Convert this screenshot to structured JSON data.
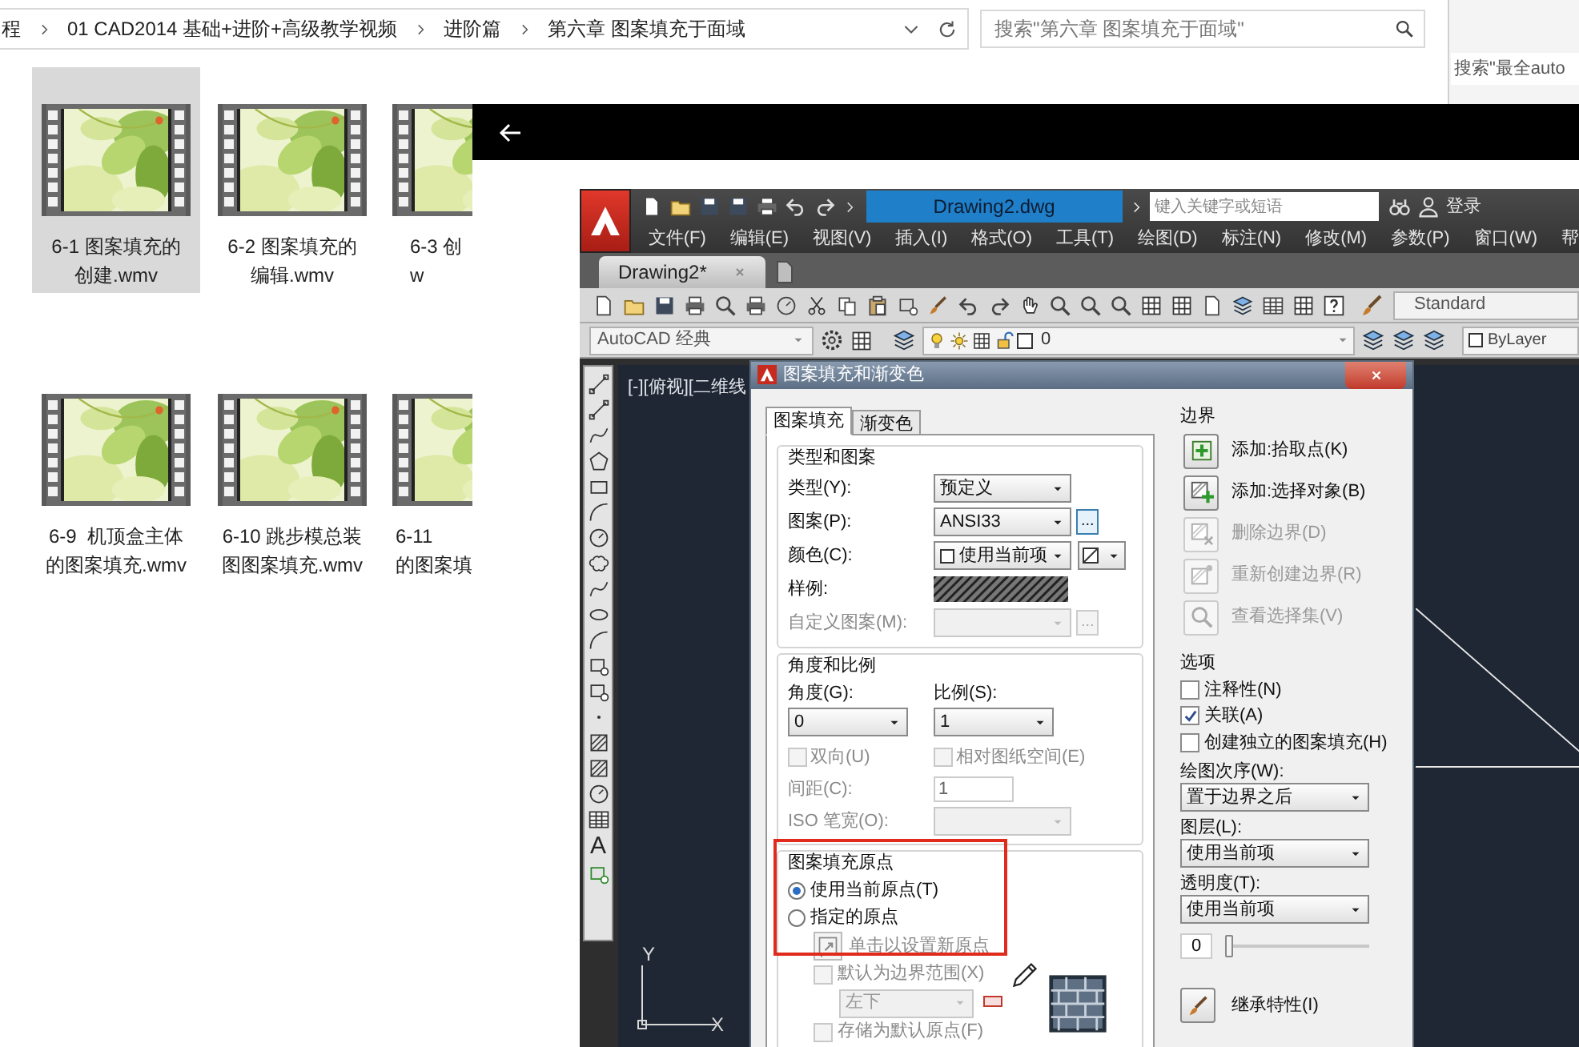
{
  "explorer": {
    "breadcrumb": [
      "程",
      "01 CAD2014 基础+进阶+高级教学视频",
      "进阶篇",
      "第六章 图案填充于面域"
    ],
    "search": {
      "placeholder": "搜索\"第六章 图案填充于面域\""
    },
    "files": [
      {
        "lines": [
          "6-1 图案填充的",
          "创建.wmv"
        ],
        "selected": true
      },
      {
        "lines": [
          "6-2 图案填充的",
          "编辑.wmv"
        ],
        "selected": false
      },
      {
        "lines": [
          "6-3 创",
          "w"
        ],
        "selected": false
      },
      {
        "lines": [
          "6-9  机顶盒主体",
          "的图案填充.wmv"
        ],
        "selected": false
      },
      {
        "lines": [
          "6-10 跳步模总装",
          "图图案填充.wmv"
        ],
        "selected": false
      },
      {
        "lines": [
          "6-11",
          "的图案填"
        ],
        "selected": false
      }
    ]
  },
  "background_window": {
    "search": {
      "placeholder": "搜索\"最全auto"
    }
  },
  "cad": {
    "title": "Drawing2.dwg",
    "search": {
      "placeholder": "键入关键字或短语"
    },
    "sign_in": "登录",
    "menu": [
      "文件(F)",
      "编辑(E)",
      "视图(V)",
      "插入(I)",
      "格式(O)",
      "工具(T)",
      "绘图(D)",
      "标注(N)",
      "修改(M)",
      "参数(P)",
      "窗口(W)",
      "帮"
    ],
    "doc_tab": "Drawing2*",
    "text_style": "Standard",
    "workspace": "AutoCAD 经典",
    "layer": "0",
    "color_control": "ByLayer",
    "viewport_label": "[-][俯视][二维线",
    "text_tool": "A",
    "ucs": {
      "y": "Y",
      "x": "X"
    }
  },
  "dialog": {
    "title": "图案填充和渐变色",
    "tabs": [
      {
        "label": "图案填充",
        "selected": true
      },
      {
        "label": "渐变色",
        "selected": false
      }
    ],
    "type_pattern": {
      "title": "类型和图案",
      "rows": [
        {
          "kind": "dropdown",
          "label": "类型(Y):",
          "value": "预定义",
          "disabled": false
        },
        {
          "kind": "browse",
          "label": "图案(P):",
          "value": "ANSI33",
          "browse": "...",
          "disabled": false
        },
        {
          "kind": "color",
          "label": "颜色(C):",
          "value": "使用当前项",
          "disabled": false
        },
        {
          "kind": "swatch",
          "label": "样例:"
        },
        {
          "kind": "browse",
          "label": "自定义图案(M):",
          "browse": "...",
          "disabled": true
        }
      ]
    },
    "angle_scale": {
      "title": "角度和比例",
      "angle": {
        "label": "角度(G):",
        "value": "0"
      },
      "scale": {
        "label": "比例(S):",
        "value": "1"
      },
      "checks": [
        {
          "label": "双向(U)",
          "checked": false,
          "disabled": true
        },
        {
          "label": "相对图纸空间(E)",
          "checked": false,
          "disabled": true
        }
      ],
      "spacing": {
        "label": "间距(C):",
        "value": "1",
        "disabled": true
      },
      "iso": {
        "label": "ISO 笔宽(O):",
        "disabled": true
      }
    },
    "origin": {
      "title": "图案填充原点",
      "radios": [
        {
          "label": "使用当前原点(T)",
          "selected": true
        },
        {
          "label": "指定的原点",
          "selected": false
        }
      ],
      "set_button": {
        "label": "单击以设置新原点",
        "disabled": true
      },
      "default_extents": {
        "label": "默认为边界范围(X)",
        "checked": false,
        "disabled": true
      },
      "position": {
        "value": "左下",
        "disabled": true
      },
      "store_default": {
        "label": "存储为默认原点(F)",
        "checked": false,
        "disabled": true
      }
    },
    "boundaries": {
      "title": "边界",
      "buttons": [
        {
          "kind": "pick_points",
          "label": "添加:拾取点(K)",
          "disabled": false
        },
        {
          "kind": "select_objects",
          "label": "添加:选择对象(B)",
          "disabled": false
        },
        {
          "kind": "remove",
          "label": "删除边界(D)",
          "disabled": true
        },
        {
          "kind": "recreate",
          "label": "重新创建边界(R)",
          "disabled": true
        },
        {
          "kind": "view_selection",
          "label": "查看选择集(V)",
          "disabled": true
        }
      ]
    },
    "options": {
      "title": "选项",
      "checks": [
        {
          "label": "注释性(N)",
          "checked": false
        },
        {
          "label": "关联(A)",
          "checked": true
        },
        {
          "label": "创建独立的图案填充(H)",
          "checked": false
        }
      ],
      "draw_order": {
        "label": "绘图次序(W):",
        "value": "置于边界之后"
      },
      "layer": {
        "label": "图层(L):",
        "value": "使用当前项"
      },
      "transparency": {
        "label": "透明度(T):",
        "value": "使用当前项",
        "reading": "0",
        "level": 0
      },
      "inherit": {
        "label": "继承特性(I)"
      }
    }
  }
}
